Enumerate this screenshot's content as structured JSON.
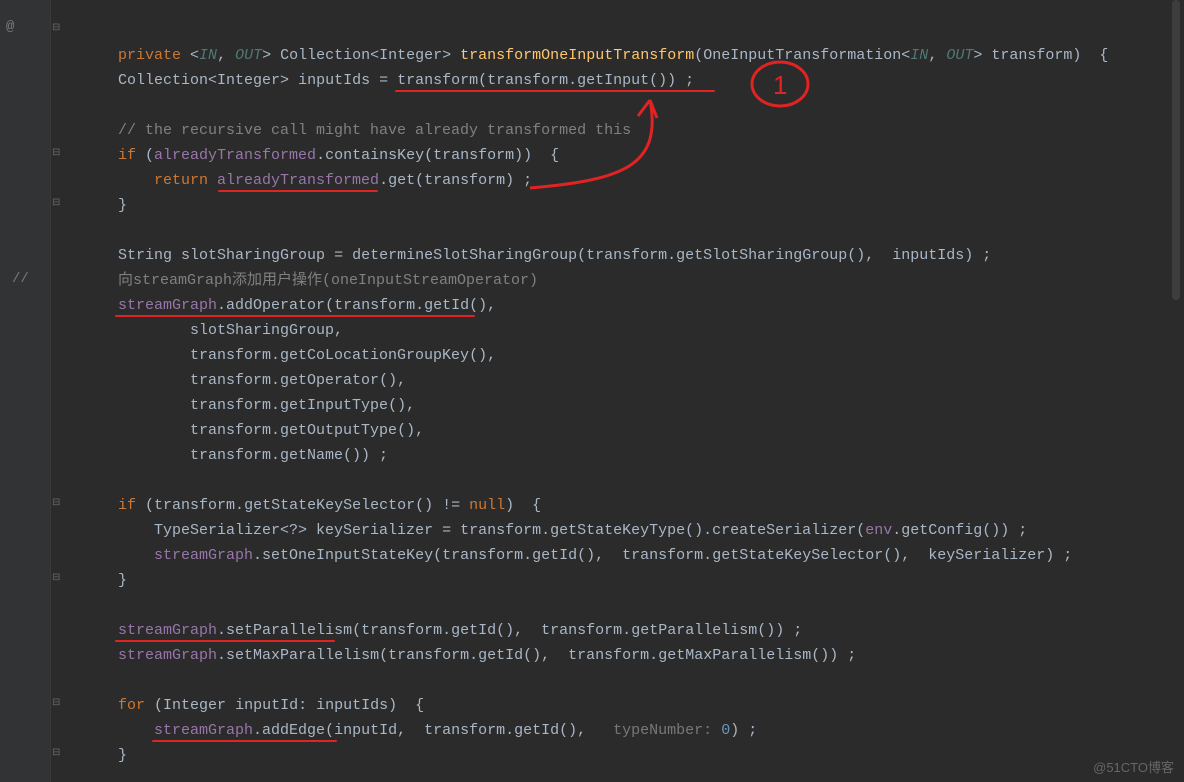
{
  "gutter": {
    "at": "@",
    "comment_marker": "//"
  },
  "code": {
    "l1": {
      "private": "private",
      "in": "IN",
      "out": "OUT",
      "coll": "Collection",
      "int": "Integer",
      "method": "transformOneInputTransform",
      "paramtype": "OneInputTransformation",
      "paramname": "transform"
    },
    "l3": {
      "coll": "Collection",
      "int": "Integer",
      "var": "inputIds",
      "eq": " = ",
      "call": "transform",
      "arg": "transform",
      "getInput": "getInput"
    },
    "l5": {
      "comment": "// the recursive call might have already transformed this"
    },
    "l6": {
      "if": "if",
      "obj": "alreadyTransformed",
      "containsKey": "containsKey",
      "arg": "transform"
    },
    "l7": {
      "return": "return",
      "obj": "alreadyTransformed",
      "get": "get",
      "arg": "transform"
    },
    "l10": {
      "type": "String",
      "var": "slotSharingGroup",
      "eq": " = ",
      "call": "determineSlotSharingGroup",
      "arg1": "transform",
      "m1": "getSlotSharingGroup",
      "arg2": "inputIds"
    },
    "l11": {
      "comment": "向streamGraph添加用户操作(oneInputStreamOperator)"
    },
    "l12": {
      "obj": "streamGraph",
      "addOperator": "addOperator",
      "arg": "transform",
      "getId": "getId"
    },
    "l13": {
      "v": "slotSharingGroup"
    },
    "l14": {
      "obj": "transform",
      "m": "getCoLocationGroupKey"
    },
    "l15": {
      "obj": "transform",
      "m": "getOperator"
    },
    "l16": {
      "obj": "transform",
      "m": "getInputType"
    },
    "l17": {
      "obj": "transform",
      "m": "getOutputType"
    },
    "l18": {
      "obj": "transform",
      "m": "getName"
    },
    "l20": {
      "if": "if",
      "arg": "transform",
      "m": "getStateKeySelector",
      "neq": " != ",
      "null": "null"
    },
    "l21": {
      "type": "TypeSerializer",
      "var": "keySerializer",
      "eq": " = ",
      "arg": "transform",
      "m1": "getStateKeyType",
      "m2": "createSerializer",
      "env": "env",
      "m3": "getConfig"
    },
    "l22": {
      "obj": "streamGraph",
      "m": "setOneInputStateKey",
      "arg": "transform",
      "getId": "getId",
      "m2": "getStateKeySelector",
      "v": "keySerializer"
    },
    "l25": {
      "obj": "streamGraph",
      "m": "setParallelism",
      "arg": "transform",
      "getId": "getId",
      "m2": "getParallelism"
    },
    "l26": {
      "obj": "streamGraph",
      "m": "setMaxParallelism",
      "arg": "transform",
      "getId": "getId",
      "m2": "getMaxParallelism"
    },
    "l28": {
      "for": "for",
      "type": "Integer",
      "var": "inputId",
      "in": "inputIds"
    },
    "l29": {
      "obj": "streamGraph",
      "m": "addEdge",
      "arg1": "inputId",
      "arg2": "transform",
      "getId": "getId",
      "hint": "typeNumber:",
      "zero": "0"
    }
  },
  "watermark": "@51CTO博客"
}
